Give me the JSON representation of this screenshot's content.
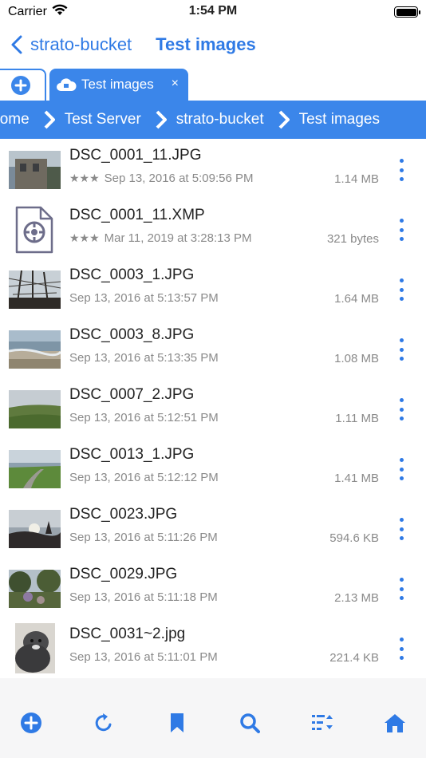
{
  "status": {
    "carrier": "Carrier",
    "time": "1:54 PM"
  },
  "nav": {
    "back_label": "strato-bucket",
    "title": "Test images"
  },
  "tabs": {
    "active_label": "Test images",
    "close_glyph": "×"
  },
  "breadcrumb": [
    {
      "label": "Home"
    },
    {
      "label": "Test Server"
    },
    {
      "label": "strato-bucket"
    },
    {
      "label": "Test images"
    }
  ],
  "files": [
    {
      "name": "DSC_0001_11.JPG",
      "stars": "★★★",
      "date": "Sep 13, 2016 at 5:09:56 PM",
      "size": "1.14 MB",
      "thumb": "building"
    },
    {
      "name": "DSC_0001_11.XMP",
      "stars": "★★★",
      "date": "Mar 11, 2019 at 3:28:13 PM",
      "size": "321 bytes",
      "thumb": "xmp-file-icon"
    },
    {
      "name": "DSC_0003_1.JPG",
      "stars": "",
      "date": "Sep 13, 2016 at 5:13:57 PM",
      "size": "1.64 MB",
      "thumb": "ship-rigging"
    },
    {
      "name": "DSC_0003_8.JPG",
      "stars": "",
      "date": "Sep 13, 2016 at 5:13:35 PM",
      "size": "1.08 MB",
      "thumb": "beach"
    },
    {
      "name": "DSC_0007_2.JPG",
      "stars": "",
      "date": "Sep 13, 2016 at 5:12:51 PM",
      "size": "1.11 MB",
      "thumb": "field"
    },
    {
      "name": "DSC_0013_1.JPG",
      "stars": "",
      "date": "Sep 13, 2016 at 5:12:12 PM",
      "size": "1.41 MB",
      "thumb": "path"
    },
    {
      "name": "DSC_0023.JPG",
      "stars": "",
      "date": "Sep 13, 2016 at 5:11:26 PM",
      "size": "594.6 KB",
      "thumb": "sunset"
    },
    {
      "name": "DSC_0029.JPG",
      "stars": "",
      "date": "Sep 13, 2016 at 5:11:18 PM",
      "size": "2.13 MB",
      "thumb": "trees"
    },
    {
      "name": "DSC_0031~2.jpg",
      "stars": "",
      "date": "Sep 13, 2016 at 5:11:01 PM",
      "size": "221.4 KB",
      "thumb": "dog"
    }
  ],
  "toolbar": [
    {
      "icon": "add-circle-icon"
    },
    {
      "icon": "refresh-icon"
    },
    {
      "icon": "bookmark-icon"
    },
    {
      "icon": "search-icon"
    },
    {
      "icon": "sort-list-icon"
    },
    {
      "icon": "home-icon"
    }
  ],
  "colors": {
    "accent": "#3b86ea",
    "link": "#2f7ae5",
    "meta": "#8a8a8a"
  }
}
